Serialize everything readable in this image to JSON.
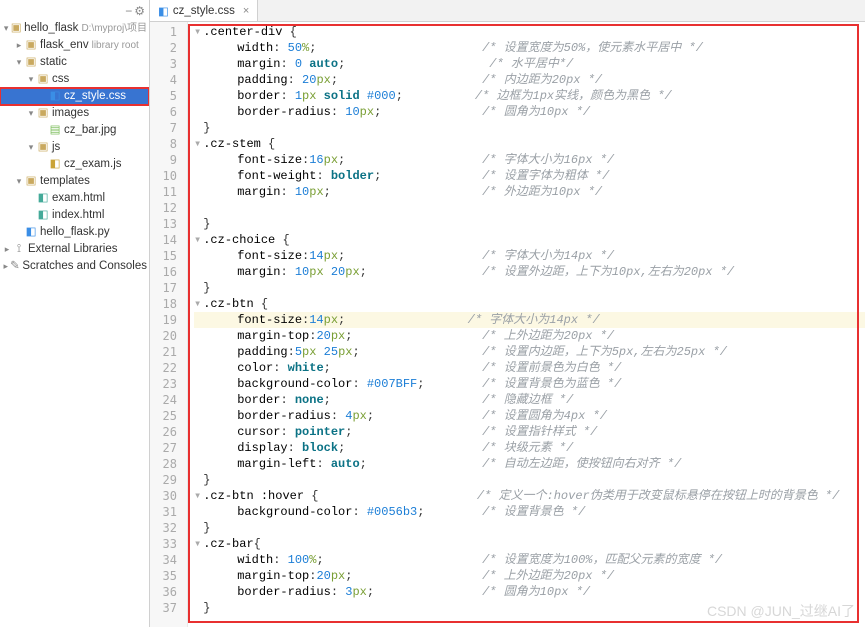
{
  "tabs": [
    {
      "label": "cz_style.css",
      "active": true
    }
  ],
  "tree": [
    {
      "depth": 0,
      "arrow": "▾",
      "icon": "▣",
      "iconCls": "icn-folder",
      "label": "hello_flask",
      "hint": "D:\\myproj\\项目"
    },
    {
      "depth": 1,
      "arrow": "▸",
      "icon": "▣",
      "iconCls": "icn-folder",
      "label": "flask_env",
      "hint": "library root"
    },
    {
      "depth": 1,
      "arrow": "▾",
      "icon": "▣",
      "iconCls": "icn-folder",
      "label": "static"
    },
    {
      "depth": 2,
      "arrow": "▾",
      "icon": "▣",
      "iconCls": "icn-folder",
      "label": "css"
    },
    {
      "depth": 3,
      "arrow": "",
      "icon": "◧",
      "iconCls": "icn-css",
      "label": "cz_style.css",
      "selected": true,
      "boxed": true
    },
    {
      "depth": 2,
      "arrow": "▾",
      "icon": "▣",
      "iconCls": "icn-folder",
      "label": "images"
    },
    {
      "depth": 3,
      "arrow": "",
      "icon": "▤",
      "iconCls": "icn-img",
      "label": "cz_bar.jpg"
    },
    {
      "depth": 2,
      "arrow": "▾",
      "icon": "▣",
      "iconCls": "icn-folder",
      "label": "js"
    },
    {
      "depth": 3,
      "arrow": "",
      "icon": "◧",
      "iconCls": "icn-js",
      "label": "cz_exam.js"
    },
    {
      "depth": 1,
      "arrow": "▾",
      "icon": "▣",
      "iconCls": "icn-folder",
      "label": "templates"
    },
    {
      "depth": 2,
      "arrow": "",
      "icon": "◧",
      "iconCls": "icn-html",
      "label": "exam.html"
    },
    {
      "depth": 2,
      "arrow": "",
      "icon": "◧",
      "iconCls": "icn-html",
      "label": "index.html"
    },
    {
      "depth": 1,
      "arrow": "",
      "icon": "◧",
      "iconCls": "icn-py",
      "label": "hello_flask.py"
    },
    {
      "depth": 0,
      "arrow": "▸",
      "icon": "⟟",
      "iconCls": "icn-lib",
      "label": "External Libraries"
    },
    {
      "depth": 0,
      "arrow": "▸",
      "icon": "✎",
      "iconCls": "icn-lib",
      "label": "Scratches and Consoles"
    }
  ],
  "code": [
    {
      "n": 1,
      "html": "<span class='fold'>▾</span><span class='sel'>.center-div</span> {"
    },
    {
      "n": 2,
      "html": "      <span class='prop'>width</span>: <span class='num'>50</span><span class='unit'>%</span>;                       <span class='cmt'>/* 设置宽度为50%，使元素水平居中 */</span>"
    },
    {
      "n": 3,
      "html": "      <span class='prop'>margin</span>: <span class='num'>0</span> <span class='kw'>auto</span>;                    <span class='cmt'>/* 水平居中*/</span>"
    },
    {
      "n": 4,
      "html": "      <span class='prop'>padding</span>: <span class='num'>20</span><span class='unit'>px</span>;                    <span class='cmt'>/* 内边距为20px */</span>"
    },
    {
      "n": 5,
      "html": "      <span class='prop'>border</span>: <span class='num'>1</span><span class='unit'>px</span> <span class='kw'>solid</span> <span class='hex'>#000</span>;          <span class='cmt'>/* 边框为1px实线，颜色为黑色 */</span>"
    },
    {
      "n": 6,
      "html": "      <span class='prop'>border-radius</span>: <span class='num'>10</span><span class='unit'>px</span>;              <span class='cmt'>/* 圆角为10px */</span>"
    },
    {
      "n": 7,
      "html": "<span class='fold'> </span>}"
    },
    {
      "n": 8,
      "html": "<span class='fold'>▾</span><span class='sel'>.cz-stem</span> {"
    },
    {
      "n": 9,
      "html": "      <span class='prop'>font-size</span>:<span class='num'>16</span><span class='unit'>px</span>;                   <span class='cmt'>/* 字体大小为16px */</span>"
    },
    {
      "n": 10,
      "html": "      <span class='prop'>font-weight</span>: <span class='kw'>bolder</span>;              <span class='cmt'>/* 设置字体为粗体 */</span>"
    },
    {
      "n": 11,
      "html": "      <span class='prop'>margin</span>: <span class='num'>10</span><span class='unit'>px</span>;                     <span class='cmt'>/* 外边距为10px */</span>"
    },
    {
      "n": 12,
      "html": " "
    },
    {
      "n": 13,
      "html": "<span class='fold'> </span>}"
    },
    {
      "n": 14,
      "html": "<span class='fold'>▾</span><span class='sel'>.cz-choice</span> {"
    },
    {
      "n": 15,
      "html": "      <span class='prop'>font-size</span>:<span class='num'>14</span><span class='unit'>px</span>;                   <span class='cmt'>/* 字体大小为14px */</span>"
    },
    {
      "n": 16,
      "html": "      <span class='prop'>margin</span>: <span class='num'>10</span><span class='unit'>px</span> <span class='num'>20</span><span class='unit'>px</span>;                <span class='cmt'>/* 设置外边距，上下为10px,左右为20px */</span>"
    },
    {
      "n": 17,
      "html": "<span class='fold'> </span>}"
    },
    {
      "n": 18,
      "html": "<span class='fold'>▾</span><span class='sel'>.cz-btn</span> {"
    },
    {
      "n": 19,
      "hl": true,
      "html": "      <span class='prop'>font-size</span>:<span class='num'>14</span><span class='unit'>px</span>;                 <span class='cmt'>/* 字体大小为14px */</span>"
    },
    {
      "n": 20,
      "html": "      <span class='prop'>margin-top</span>:<span class='num'>20</span><span class='unit'>px</span>;                  <span class='cmt'>/* 上外边距为20px */</span>"
    },
    {
      "n": 21,
      "html": "      <span class='prop'>padding</span>:<span class='num'>5</span><span class='unit'>px</span> <span class='num'>25</span><span class='unit'>px</span>;                 <span class='cmt'>/* 设置内边距，上下为5px,左右为25px */</span>"
    },
    {
      "n": 22,
      "html": "      <span class='prop'>color</span>: <span class='kw'>white</span>;                     <span class='cmt'>/* 设置前景色为白色 */</span>"
    },
    {
      "n": 23,
      "html": "      <span class='prop'>background-color</span>: <span class='hex'>#007BFF</span>;        <span class='cmt'>/* 设置背景色为蓝色 */</span>"
    },
    {
      "n": 24,
      "html": "      <span class='prop'>border</span>: <span class='kw'>none</span>;                     <span class='cmt'>/* 隐藏边框 */</span>"
    },
    {
      "n": 25,
      "html": "      <span class='prop'>border-radius</span>: <span class='num'>4</span><span class='unit'>px</span>;               <span class='cmt'>/* 设置圆角为4px */</span>"
    },
    {
      "n": 26,
      "html": "      <span class='prop'>cursor</span>: <span class='kw'>pointer</span>;                  <span class='cmt'>/* 设置指针样式 */</span>"
    },
    {
      "n": 27,
      "html": "      <span class='prop'>display</span>: <span class='kw'>block</span>;                   <span class='cmt'>/* 块级元素 */</span>"
    },
    {
      "n": 28,
      "html": "      <span class='prop'>margin-left</span>: <span class='kw'>auto</span>;                <span class='cmt'>/* 自动左边距，使按钮向右对齐 */</span>"
    },
    {
      "n": 29,
      "html": "<span class='fold'> </span>}"
    },
    {
      "n": 30,
      "html": "<span class='fold'>▾</span><span class='sel'>.cz-btn</span> <span class='sel'>:hover</span> {                      <span class='cmt'>/* 定义一个:hover伪类用于改变鼠标悬停在按钮上时的背景色 */</span>"
    },
    {
      "n": 31,
      "html": "      <span class='prop'>background-color</span>: <span class='hex'>#0056b3</span>;        <span class='cmt'>/* 设置背景色 */</span>"
    },
    {
      "n": 32,
      "html": "<span class='fold'> </span>}"
    },
    {
      "n": 33,
      "html": "<span class='fold'>▾</span><span class='sel'>.cz-bar</span>{"
    },
    {
      "n": 34,
      "html": "      <span class='prop'>width</span>: <span class='num'>100</span><span class='unit'>%</span>;                      <span class='cmt'>/* 设置宽度为100%，匹配父元素的宽度 */</span>"
    },
    {
      "n": 35,
      "html": "      <span class='prop'>margin-top</span>:<span class='num'>20</span><span class='unit'>px</span>;                  <span class='cmt'>/* 上外边距为20px */</span>"
    },
    {
      "n": 36,
      "html": "      <span class='prop'>border-radius</span>: <span class='num'>3</span><span class='unit'>px</span>;               <span class='cmt'>/* 圆角为10px */</span>"
    },
    {
      "n": 37,
      "html": "<span class='fold'> </span>}"
    }
  ],
  "watermark": "CSDN @JUN_过继AI了"
}
